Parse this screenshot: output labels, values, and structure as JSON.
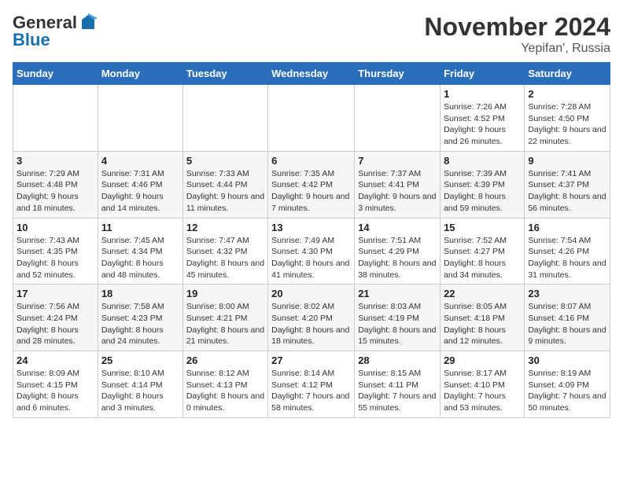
{
  "logo": {
    "general": "General",
    "blue": "Blue"
  },
  "title": "November 2024",
  "subtitle": "Yepifan', Russia",
  "days_of_week": [
    "Sunday",
    "Monday",
    "Tuesday",
    "Wednesday",
    "Thursday",
    "Friday",
    "Saturday"
  ],
  "weeks": [
    [
      {
        "day": "",
        "info": ""
      },
      {
        "day": "",
        "info": ""
      },
      {
        "day": "",
        "info": ""
      },
      {
        "day": "",
        "info": ""
      },
      {
        "day": "",
        "info": ""
      },
      {
        "day": "1",
        "info": "Sunrise: 7:26 AM\nSunset: 4:52 PM\nDaylight: 9 hours and 26 minutes."
      },
      {
        "day": "2",
        "info": "Sunrise: 7:28 AM\nSunset: 4:50 PM\nDaylight: 9 hours and 22 minutes."
      }
    ],
    [
      {
        "day": "3",
        "info": "Sunrise: 7:29 AM\nSunset: 4:48 PM\nDaylight: 9 hours and 18 minutes."
      },
      {
        "day": "4",
        "info": "Sunrise: 7:31 AM\nSunset: 4:46 PM\nDaylight: 9 hours and 14 minutes."
      },
      {
        "day": "5",
        "info": "Sunrise: 7:33 AM\nSunset: 4:44 PM\nDaylight: 9 hours and 11 minutes."
      },
      {
        "day": "6",
        "info": "Sunrise: 7:35 AM\nSunset: 4:42 PM\nDaylight: 9 hours and 7 minutes."
      },
      {
        "day": "7",
        "info": "Sunrise: 7:37 AM\nSunset: 4:41 PM\nDaylight: 9 hours and 3 minutes."
      },
      {
        "day": "8",
        "info": "Sunrise: 7:39 AM\nSunset: 4:39 PM\nDaylight: 8 hours and 59 minutes."
      },
      {
        "day": "9",
        "info": "Sunrise: 7:41 AM\nSunset: 4:37 PM\nDaylight: 8 hours and 56 minutes."
      }
    ],
    [
      {
        "day": "10",
        "info": "Sunrise: 7:43 AM\nSunset: 4:35 PM\nDaylight: 8 hours and 52 minutes."
      },
      {
        "day": "11",
        "info": "Sunrise: 7:45 AM\nSunset: 4:34 PM\nDaylight: 8 hours and 48 minutes."
      },
      {
        "day": "12",
        "info": "Sunrise: 7:47 AM\nSunset: 4:32 PM\nDaylight: 8 hours and 45 minutes."
      },
      {
        "day": "13",
        "info": "Sunrise: 7:49 AM\nSunset: 4:30 PM\nDaylight: 8 hours and 41 minutes."
      },
      {
        "day": "14",
        "info": "Sunrise: 7:51 AM\nSunset: 4:29 PM\nDaylight: 8 hours and 38 minutes."
      },
      {
        "day": "15",
        "info": "Sunrise: 7:52 AM\nSunset: 4:27 PM\nDaylight: 8 hours and 34 minutes."
      },
      {
        "day": "16",
        "info": "Sunrise: 7:54 AM\nSunset: 4:26 PM\nDaylight: 8 hours and 31 minutes."
      }
    ],
    [
      {
        "day": "17",
        "info": "Sunrise: 7:56 AM\nSunset: 4:24 PM\nDaylight: 8 hours and 28 minutes."
      },
      {
        "day": "18",
        "info": "Sunrise: 7:58 AM\nSunset: 4:23 PM\nDaylight: 8 hours and 24 minutes."
      },
      {
        "day": "19",
        "info": "Sunrise: 8:00 AM\nSunset: 4:21 PM\nDaylight: 8 hours and 21 minutes."
      },
      {
        "day": "20",
        "info": "Sunrise: 8:02 AM\nSunset: 4:20 PM\nDaylight: 8 hours and 18 minutes."
      },
      {
        "day": "21",
        "info": "Sunrise: 8:03 AM\nSunset: 4:19 PM\nDaylight: 8 hours and 15 minutes."
      },
      {
        "day": "22",
        "info": "Sunrise: 8:05 AM\nSunset: 4:18 PM\nDaylight: 8 hours and 12 minutes."
      },
      {
        "day": "23",
        "info": "Sunrise: 8:07 AM\nSunset: 4:16 PM\nDaylight: 8 hours and 9 minutes."
      }
    ],
    [
      {
        "day": "24",
        "info": "Sunrise: 8:09 AM\nSunset: 4:15 PM\nDaylight: 8 hours and 6 minutes."
      },
      {
        "day": "25",
        "info": "Sunrise: 8:10 AM\nSunset: 4:14 PM\nDaylight: 8 hours and 3 minutes."
      },
      {
        "day": "26",
        "info": "Sunrise: 8:12 AM\nSunset: 4:13 PM\nDaylight: 8 hours and 0 minutes."
      },
      {
        "day": "27",
        "info": "Sunrise: 8:14 AM\nSunset: 4:12 PM\nDaylight: 7 hours and 58 minutes."
      },
      {
        "day": "28",
        "info": "Sunrise: 8:15 AM\nSunset: 4:11 PM\nDaylight: 7 hours and 55 minutes."
      },
      {
        "day": "29",
        "info": "Sunrise: 8:17 AM\nSunset: 4:10 PM\nDaylight: 7 hours and 53 minutes."
      },
      {
        "day": "30",
        "info": "Sunrise: 8:19 AM\nSunset: 4:09 PM\nDaylight: 7 hours and 50 minutes."
      }
    ]
  ]
}
